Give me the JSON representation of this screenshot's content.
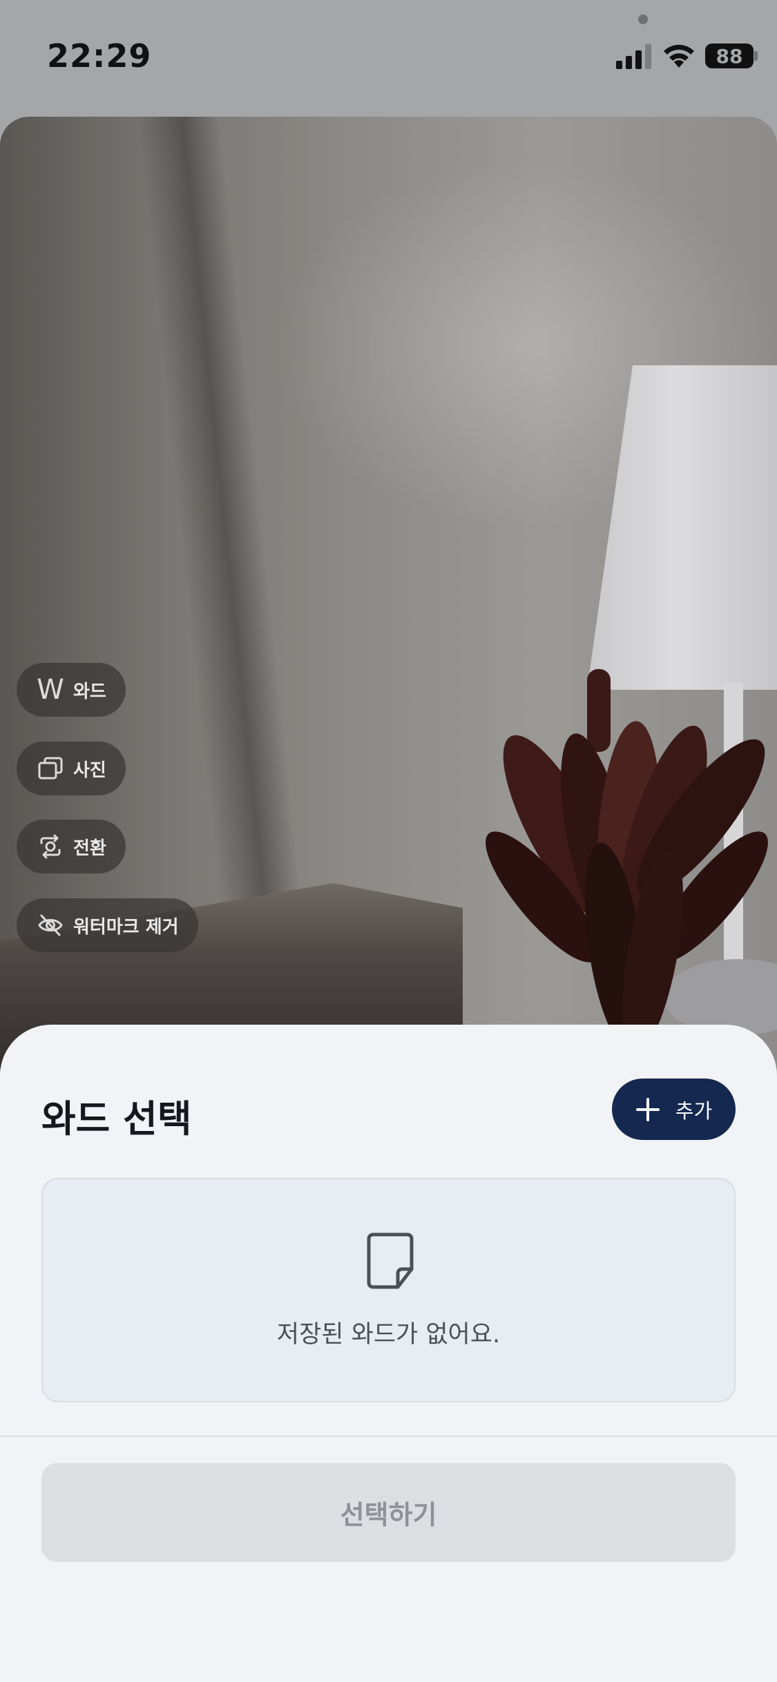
{
  "status_bar": {
    "time": "22:29",
    "battery": "88",
    "icons": [
      "signal-icon",
      "wifi-icon",
      "battery-icon"
    ]
  },
  "overlay_controls": [
    {
      "label": "와드",
      "icon": "w-letter-icon",
      "icon_text": "W"
    },
    {
      "label": "사진",
      "icon": "gallery-icon"
    },
    {
      "label": "전환",
      "icon": "camera-switch-icon"
    },
    {
      "label": "워터마크 제거",
      "icon": "eye-off-icon"
    }
  ],
  "sheet": {
    "title": "와드 선택",
    "add_label": "추가",
    "empty_message": "저장된 와드가 없어요.",
    "select_label": "선택하기"
  },
  "colors": {
    "accent": "#15284f",
    "sheet_background": "#f2f3f6",
    "empty_card": "#e8edf4",
    "disabled_button": "#dddee2"
  }
}
